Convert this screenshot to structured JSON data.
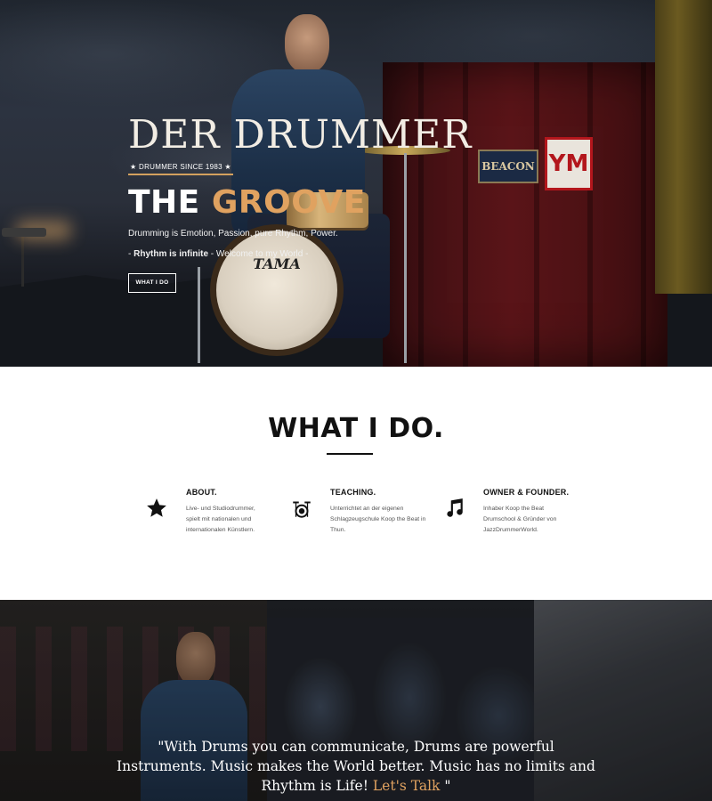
{
  "hero": {
    "brand": "DER DRUMMER",
    "badge": "★ DRUMMER SINCE 1983 ★",
    "heading_white": "THE",
    "heading_accent": "GROOVE",
    "line1": "Drumming is Emotion, Passion, pure Rhythm, Power.",
    "line2_prefix": "- ",
    "line2_bold": "Rhythm is infinite",
    "line2_suffix": " - Welcome to my World -",
    "button_label": "WHAT I DO",
    "bass_drum_brand": "TAMA",
    "sign_beacon": "BEACON",
    "sign_ym": "YM",
    "accent_color": "#e0a260"
  },
  "what": {
    "title": "WHAT I DO.",
    "features": [
      {
        "icon": "star-icon",
        "title": "ABOUT.",
        "body": "Live- und Studiodrummer, spielt mit nationalen und internationalen Künstlern."
      },
      {
        "icon": "drum-kit-icon",
        "title": "TEACHING.",
        "body": "Unterrichtet an der eigenen Schlagzeugschule Koop the Beat in Thun."
      },
      {
        "icon": "music-note-icon",
        "title": "OWNER & FOUNDER.",
        "body": "Inhaber Koop the Beat Drumschool & Gründer von JazzDrummerWorld."
      }
    ]
  },
  "quote": {
    "text": "\"With Drums you can communicate, Drums are powerful Instruments. Music makes the World better. Music has no limits and Rhythm is Life!",
    "link": "Let's Talk",
    "closing": " \""
  }
}
